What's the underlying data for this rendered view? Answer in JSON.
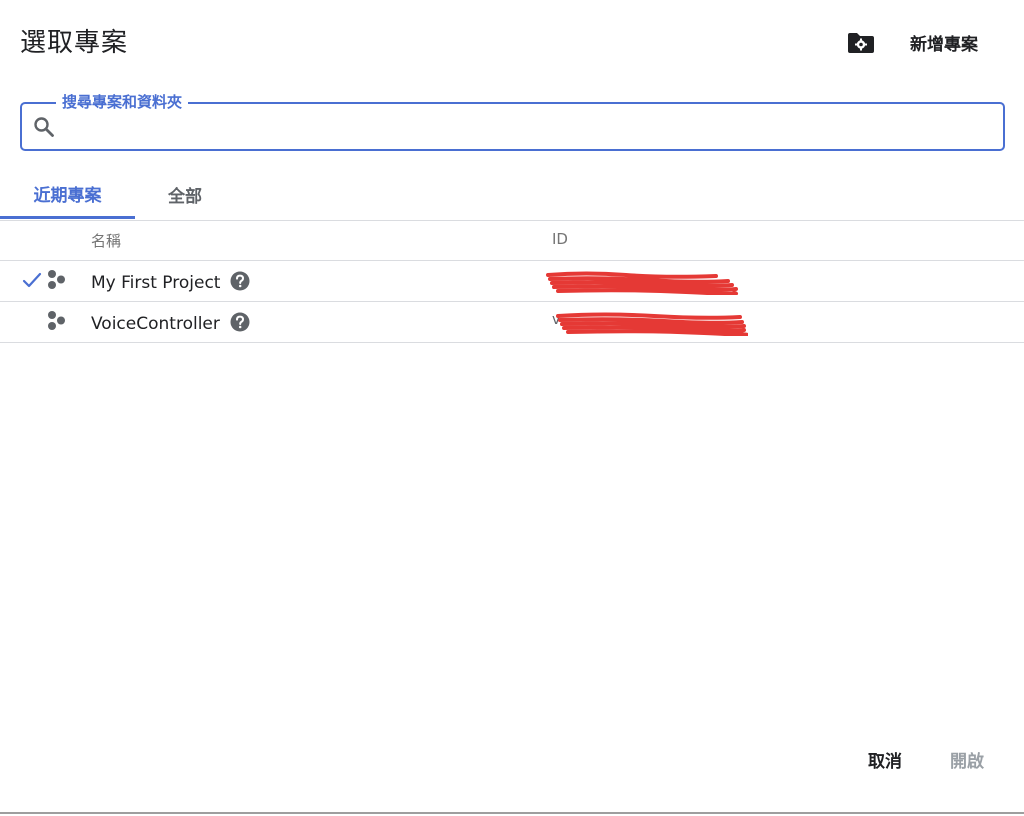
{
  "dialog": {
    "title": "選取專案",
    "new_project_label": "新增專案",
    "folder_settings_icon": "folder-settings-icon"
  },
  "search": {
    "legend": "搜尋專案和資料夾",
    "value": "",
    "placeholder": ""
  },
  "tabs": [
    {
      "label": "近期專案",
      "active": true
    },
    {
      "label": "全部",
      "active": false
    }
  ],
  "table": {
    "columns": [
      "名稱",
      "ID"
    ],
    "rows": [
      {
        "name": "My First Project",
        "selected": true,
        "id": ""
      },
      {
        "name": "VoiceController",
        "selected": false,
        "id": "v"
      }
    ]
  },
  "footer": {
    "cancel_label": "取消",
    "open_label": "開啟"
  },
  "colors": {
    "accent": "#4a6fd2",
    "redaction": "#e53935",
    "disabled": "#9aa0a6"
  }
}
